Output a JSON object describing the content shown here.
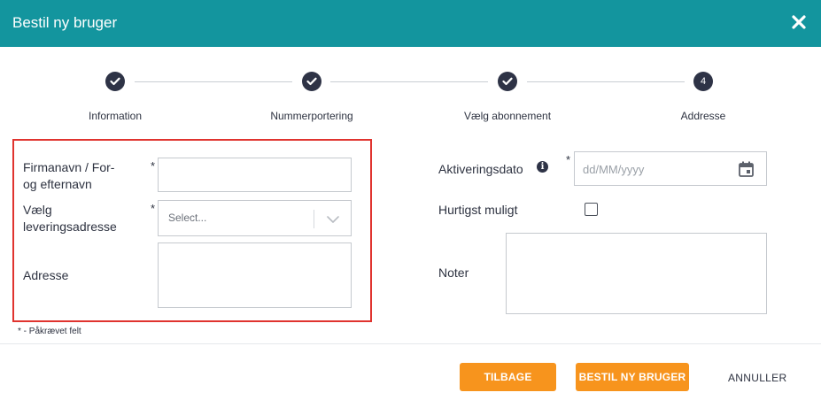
{
  "header": {
    "title": "Bestil ny bruger",
    "close_icon": "close-icon"
  },
  "stepper": {
    "steps": [
      {
        "label": "Information",
        "state": "done",
        "icon": "check-icon"
      },
      {
        "label": "Nummerportering",
        "state": "done",
        "icon": "check-icon"
      },
      {
        "label": "Vælg abonnement",
        "state": "done",
        "icon": "check-icon"
      },
      {
        "label": "Addresse",
        "state": "current",
        "number": "4"
      }
    ]
  },
  "form_left": {
    "company": {
      "label_line1": "Firmanavn / For-",
      "label_line2": "og efternavn",
      "required": "*",
      "value": ""
    },
    "delivery": {
      "label_line1": "Vælg",
      "label_line2": "leveringsadresse",
      "required": "*",
      "placeholder": "Select...",
      "chevron_icon": "chevron-down-icon"
    },
    "address": {
      "label": "Adresse",
      "value": ""
    },
    "required_note": "* - Påkrævet felt"
  },
  "form_right": {
    "activation": {
      "label": "Aktiveringsdato",
      "required": "*",
      "placeholder": "dd/MM/yyyy",
      "info_icon": "info-icon",
      "calendar_icon": "calendar-icon",
      "info_glyph": "i"
    },
    "asap": {
      "label": "Hurtigst muligt",
      "checked": false
    },
    "notes": {
      "label": "Noter",
      "value": ""
    }
  },
  "footer": {
    "back_label": "TILBAGE",
    "order_label": "BESTIL NY BRUGER",
    "cancel_label": "ANNULLER"
  },
  "colors": {
    "header": "#13959e",
    "accent": "#f7941d",
    "step": "#2e3346",
    "highlight_border": "#e0342f"
  }
}
